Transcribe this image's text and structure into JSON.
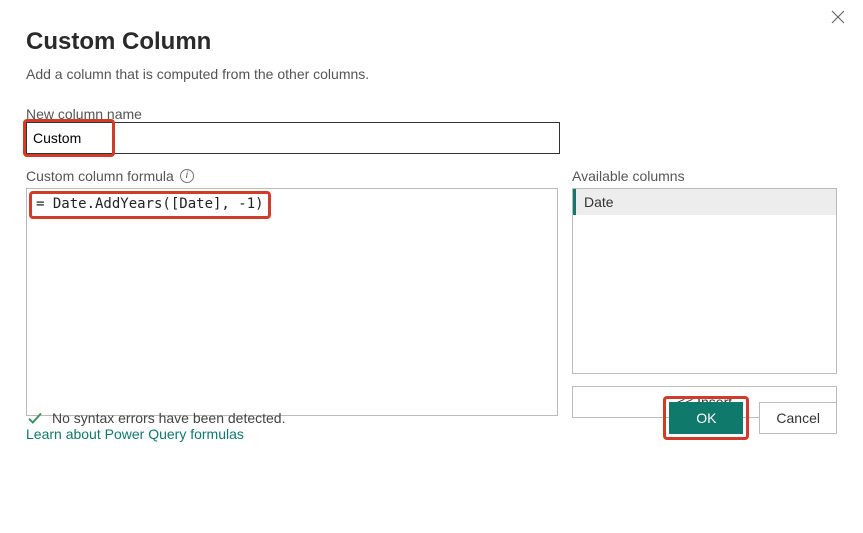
{
  "dialog": {
    "title": "Custom Column",
    "subtitle": "Add a column that is computed from the other columns."
  },
  "columnName": {
    "label": "New column name",
    "value": "Custom"
  },
  "formula": {
    "label": "Custom column formula",
    "value": "= Date.AddYears([Date], -1)"
  },
  "available": {
    "label": "Available columns",
    "items": [
      "Date"
    ],
    "insertLabel": "<< Insert"
  },
  "learnLink": "Learn about Power Query formulas",
  "status": {
    "text": "No syntax errors have been detected."
  },
  "buttons": {
    "ok": "OK",
    "cancel": "Cancel"
  }
}
